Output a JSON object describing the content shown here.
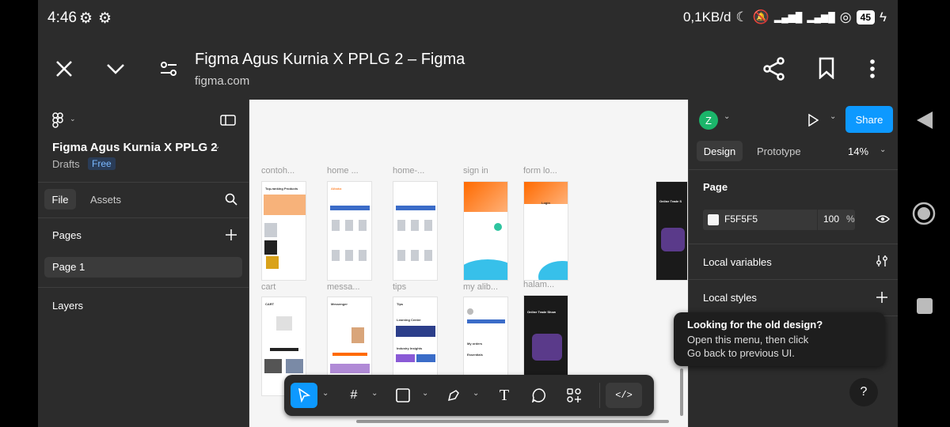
{
  "status": {
    "time": "4:46",
    "network_speed": "0,1KB/d",
    "battery": "45"
  },
  "browser": {
    "title": "Figma Agus Kurnia X PPLG 2 – Figma",
    "url": "figma.com"
  },
  "left_panel": {
    "file_name": "Figma Agus Kurnia X PPLG 2",
    "location": "Drafts",
    "plan_badge": "Free",
    "tabs": [
      "File",
      "Assets"
    ],
    "pages_label": "Pages",
    "page_item": "Page 1",
    "layers_label": "Layers"
  },
  "canvas": {
    "frame_labels": [
      "contoh...",
      "home ...",
      "home-...",
      "sign in",
      "form lo...",
      "cart",
      "messa...",
      "tips",
      "my alib...",
      "halam..."
    ],
    "frame_text": {
      "top_products": "Top-ranking Products",
      "alibaba": "Alibaba",
      "login": "Login",
      "trade_show": "Online Trade Show",
      "trade_show_2": "Online Trade S",
      "cart": "CART",
      "messenger": "Messenger",
      "tips": "Tips",
      "learning": "Learning Center",
      "industry": "Industry Insights",
      "my_orders": "My orders",
      "essentials": "Essentials"
    }
  },
  "toolbar": {
    "tools": [
      "move-tool",
      "frame-tool",
      "shape-tool",
      "pen-tool",
      "text-tool",
      "comment-tool",
      "actions-tool",
      "dev-mode-toggle"
    ],
    "text_tool_glyph": "T"
  },
  "right_panel": {
    "avatar_initial": "Z",
    "share_label": "Share",
    "tabs": [
      "Design",
      "Prototype"
    ],
    "zoom": "14%",
    "page_label": "Page",
    "page_color": "F5F5F5",
    "opacity": "100",
    "opacity_unit": "%",
    "local_variables": "Local variables",
    "local_styles": "Local styles"
  },
  "tooltip": {
    "title": "Looking for the old design?",
    "line1": "Open this menu, then click",
    "line2": "Go back to previous UI."
  },
  "help_label": "?"
}
